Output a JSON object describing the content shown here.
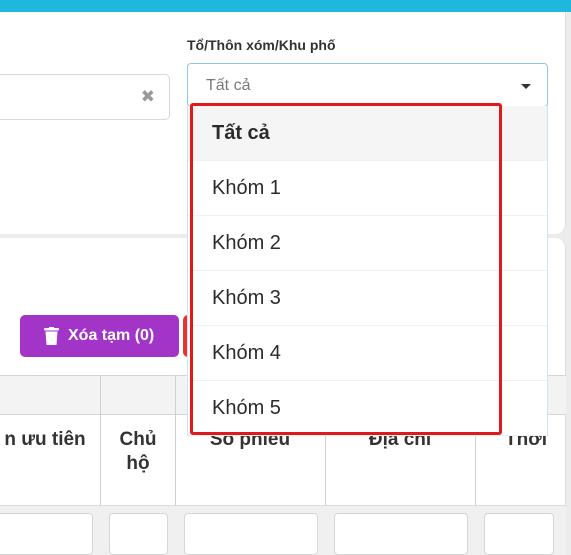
{
  "filter": {
    "label": "Tổ/Thôn xóm/Khu phố",
    "selected_value": "Tất cả",
    "options": [
      {
        "label": "Tất cả",
        "selected": true
      },
      {
        "label": "Khóm 1",
        "selected": false
      },
      {
        "label": "Khóm 2",
        "selected": false
      },
      {
        "label": "Khóm 3",
        "selected": false
      },
      {
        "label": "Khóm 4",
        "selected": false
      },
      {
        "label": "Khóm 5",
        "selected": false
      }
    ]
  },
  "search": {
    "clear_icon": "close-icon"
  },
  "toolbar": {
    "delete_label": "Xóa tạm (0)",
    "delete_icon": "trash-icon",
    "delete_color": "#a334c8"
  },
  "table": {
    "headers": [
      "n ưu tiên",
      "Chủ hộ",
      "Số phiếu",
      "Địa chỉ",
      "Thời"
    ]
  },
  "colors": {
    "accent": "#1fb7dc",
    "highlight": "#e01a1a",
    "danger": "#e8332e"
  }
}
